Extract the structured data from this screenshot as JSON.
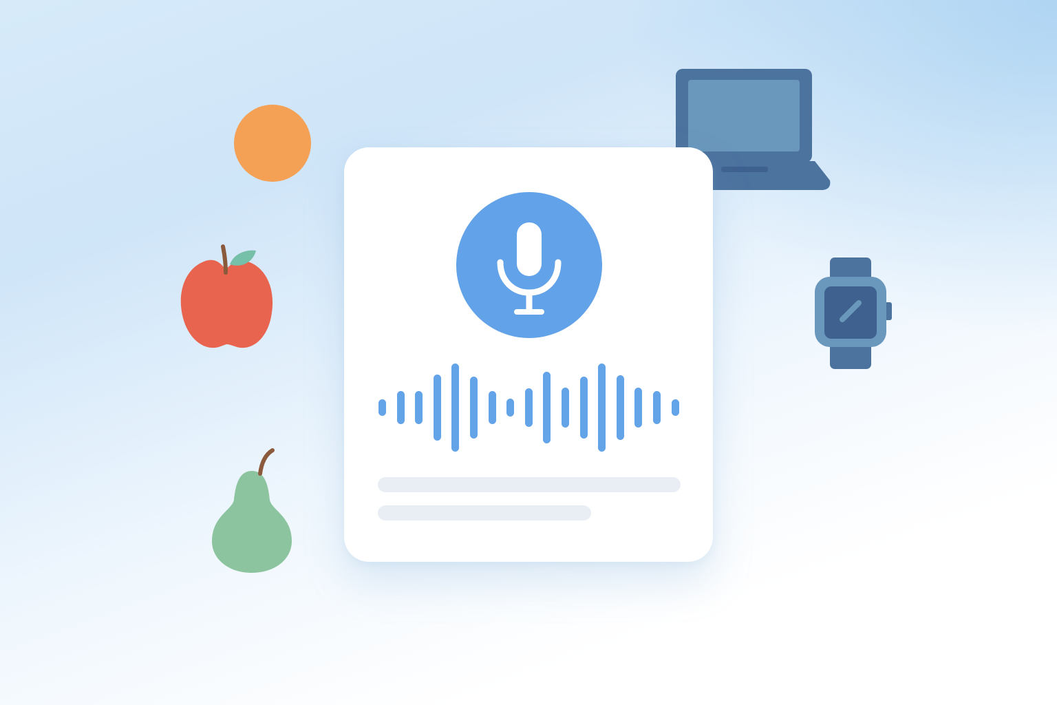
{
  "scene": {
    "background_colors": [
      "#cfe5f8",
      "#ffffff"
    ],
    "card": {
      "background": "#ffffff",
      "mic_icon": "microphone-icon",
      "mic_circle_color": "#62a2e8",
      "waveform_color": "#63a3e8",
      "waveform_levels": [
        0.18,
        0.37,
        0.37,
        0.75,
        1.0,
        0.71,
        0.37,
        0.2,
        0.43,
        0.82,
        0.45,
        0.71,
        1.0,
        0.73,
        0.45,
        0.37,
        0.18
      ],
      "placeholder_color": "#e9eef5"
    },
    "decorations": [
      {
        "icon": "orange-icon",
        "color": "#f4a055"
      },
      {
        "icon": "apple-icon",
        "color": "#e8644f"
      },
      {
        "icon": "pear-icon",
        "color": "#8dc4a0"
      },
      {
        "icon": "laptop-icon",
        "color": "#4c729e"
      },
      {
        "icon": "smartwatch-icon",
        "color": "#4c729e"
      }
    ]
  }
}
